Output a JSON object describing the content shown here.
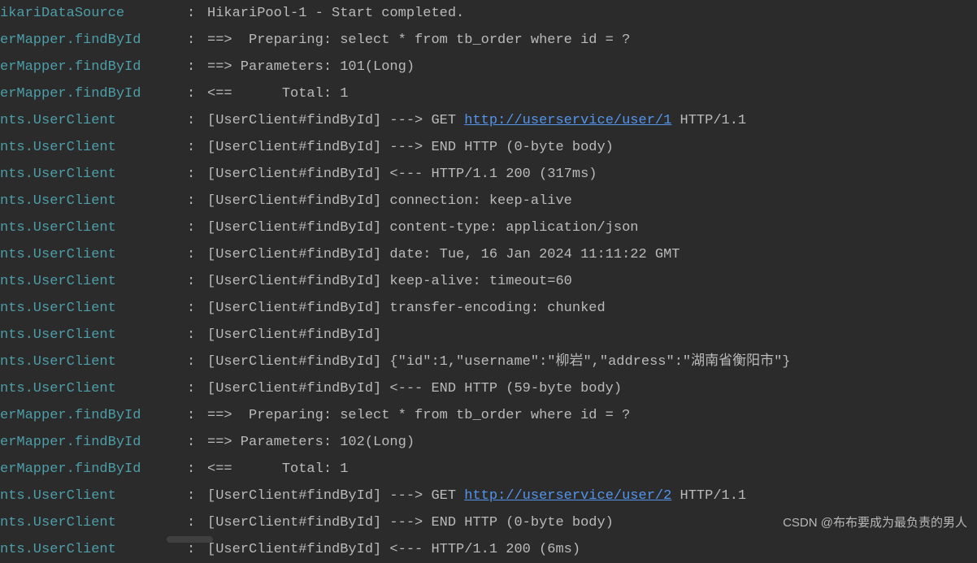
{
  "lines": [
    {
      "logger": "ikariDataSource",
      "message": "HikariPool-1 - Start completed."
    },
    {
      "logger": "erMapper.findById",
      "message": "==>  Preparing: select * from tb_order where id = ?"
    },
    {
      "logger": "erMapper.findById",
      "message": "==> Parameters: 101(Long)"
    },
    {
      "logger": "erMapper.findById",
      "message": "<==      Total: 1"
    },
    {
      "logger": "nts.UserClient",
      "message_pre": "[UserClient#findById] ---> GET ",
      "link": "http://userservice/user/1",
      "message_post": " HTTP/1.1"
    },
    {
      "logger": "nts.UserClient",
      "message": "[UserClient#findById] ---> END HTTP (0-byte body)"
    },
    {
      "logger": "nts.UserClient",
      "message": "[UserClient#findById] <--- HTTP/1.1 200 (317ms)"
    },
    {
      "logger": "nts.UserClient",
      "message": "[UserClient#findById] connection: keep-alive"
    },
    {
      "logger": "nts.UserClient",
      "message": "[UserClient#findById] content-type: application/json"
    },
    {
      "logger": "nts.UserClient",
      "message": "[UserClient#findById] date: Tue, 16 Jan 2024 11:11:22 GMT"
    },
    {
      "logger": "nts.UserClient",
      "message": "[UserClient#findById] keep-alive: timeout=60"
    },
    {
      "logger": "nts.UserClient",
      "message": "[UserClient#findById] transfer-encoding: chunked"
    },
    {
      "logger": "nts.UserClient",
      "message": "[UserClient#findById] "
    },
    {
      "logger": "nts.UserClient",
      "message": "[UserClient#findById] {\"id\":1,\"username\":\"柳岩\",\"address\":\"湖南省衡阳市\"}"
    },
    {
      "logger": "nts.UserClient",
      "message": "[UserClient#findById] <--- END HTTP (59-byte body)"
    },
    {
      "logger": "erMapper.findById",
      "message": "==>  Preparing: select * from tb_order where id = ?"
    },
    {
      "logger": "erMapper.findById",
      "message": "==> Parameters: 102(Long)"
    },
    {
      "logger": "erMapper.findById",
      "message": "<==      Total: 1"
    },
    {
      "logger": "nts.UserClient",
      "message_pre": "[UserClient#findById] ---> GET ",
      "link": "http://userservice/user/2",
      "message_post": " HTTP/1.1"
    },
    {
      "logger": "nts.UserClient",
      "message": "[UserClient#findById] ---> END HTTP (0-byte body)"
    },
    {
      "logger": "nts.UserClient",
      "message": "[UserClient#findById] <--- HTTP/1.1 200 (6ms)"
    }
  ],
  "colon": ": ",
  "watermark": "CSDN @布布要成为最负责的男人"
}
